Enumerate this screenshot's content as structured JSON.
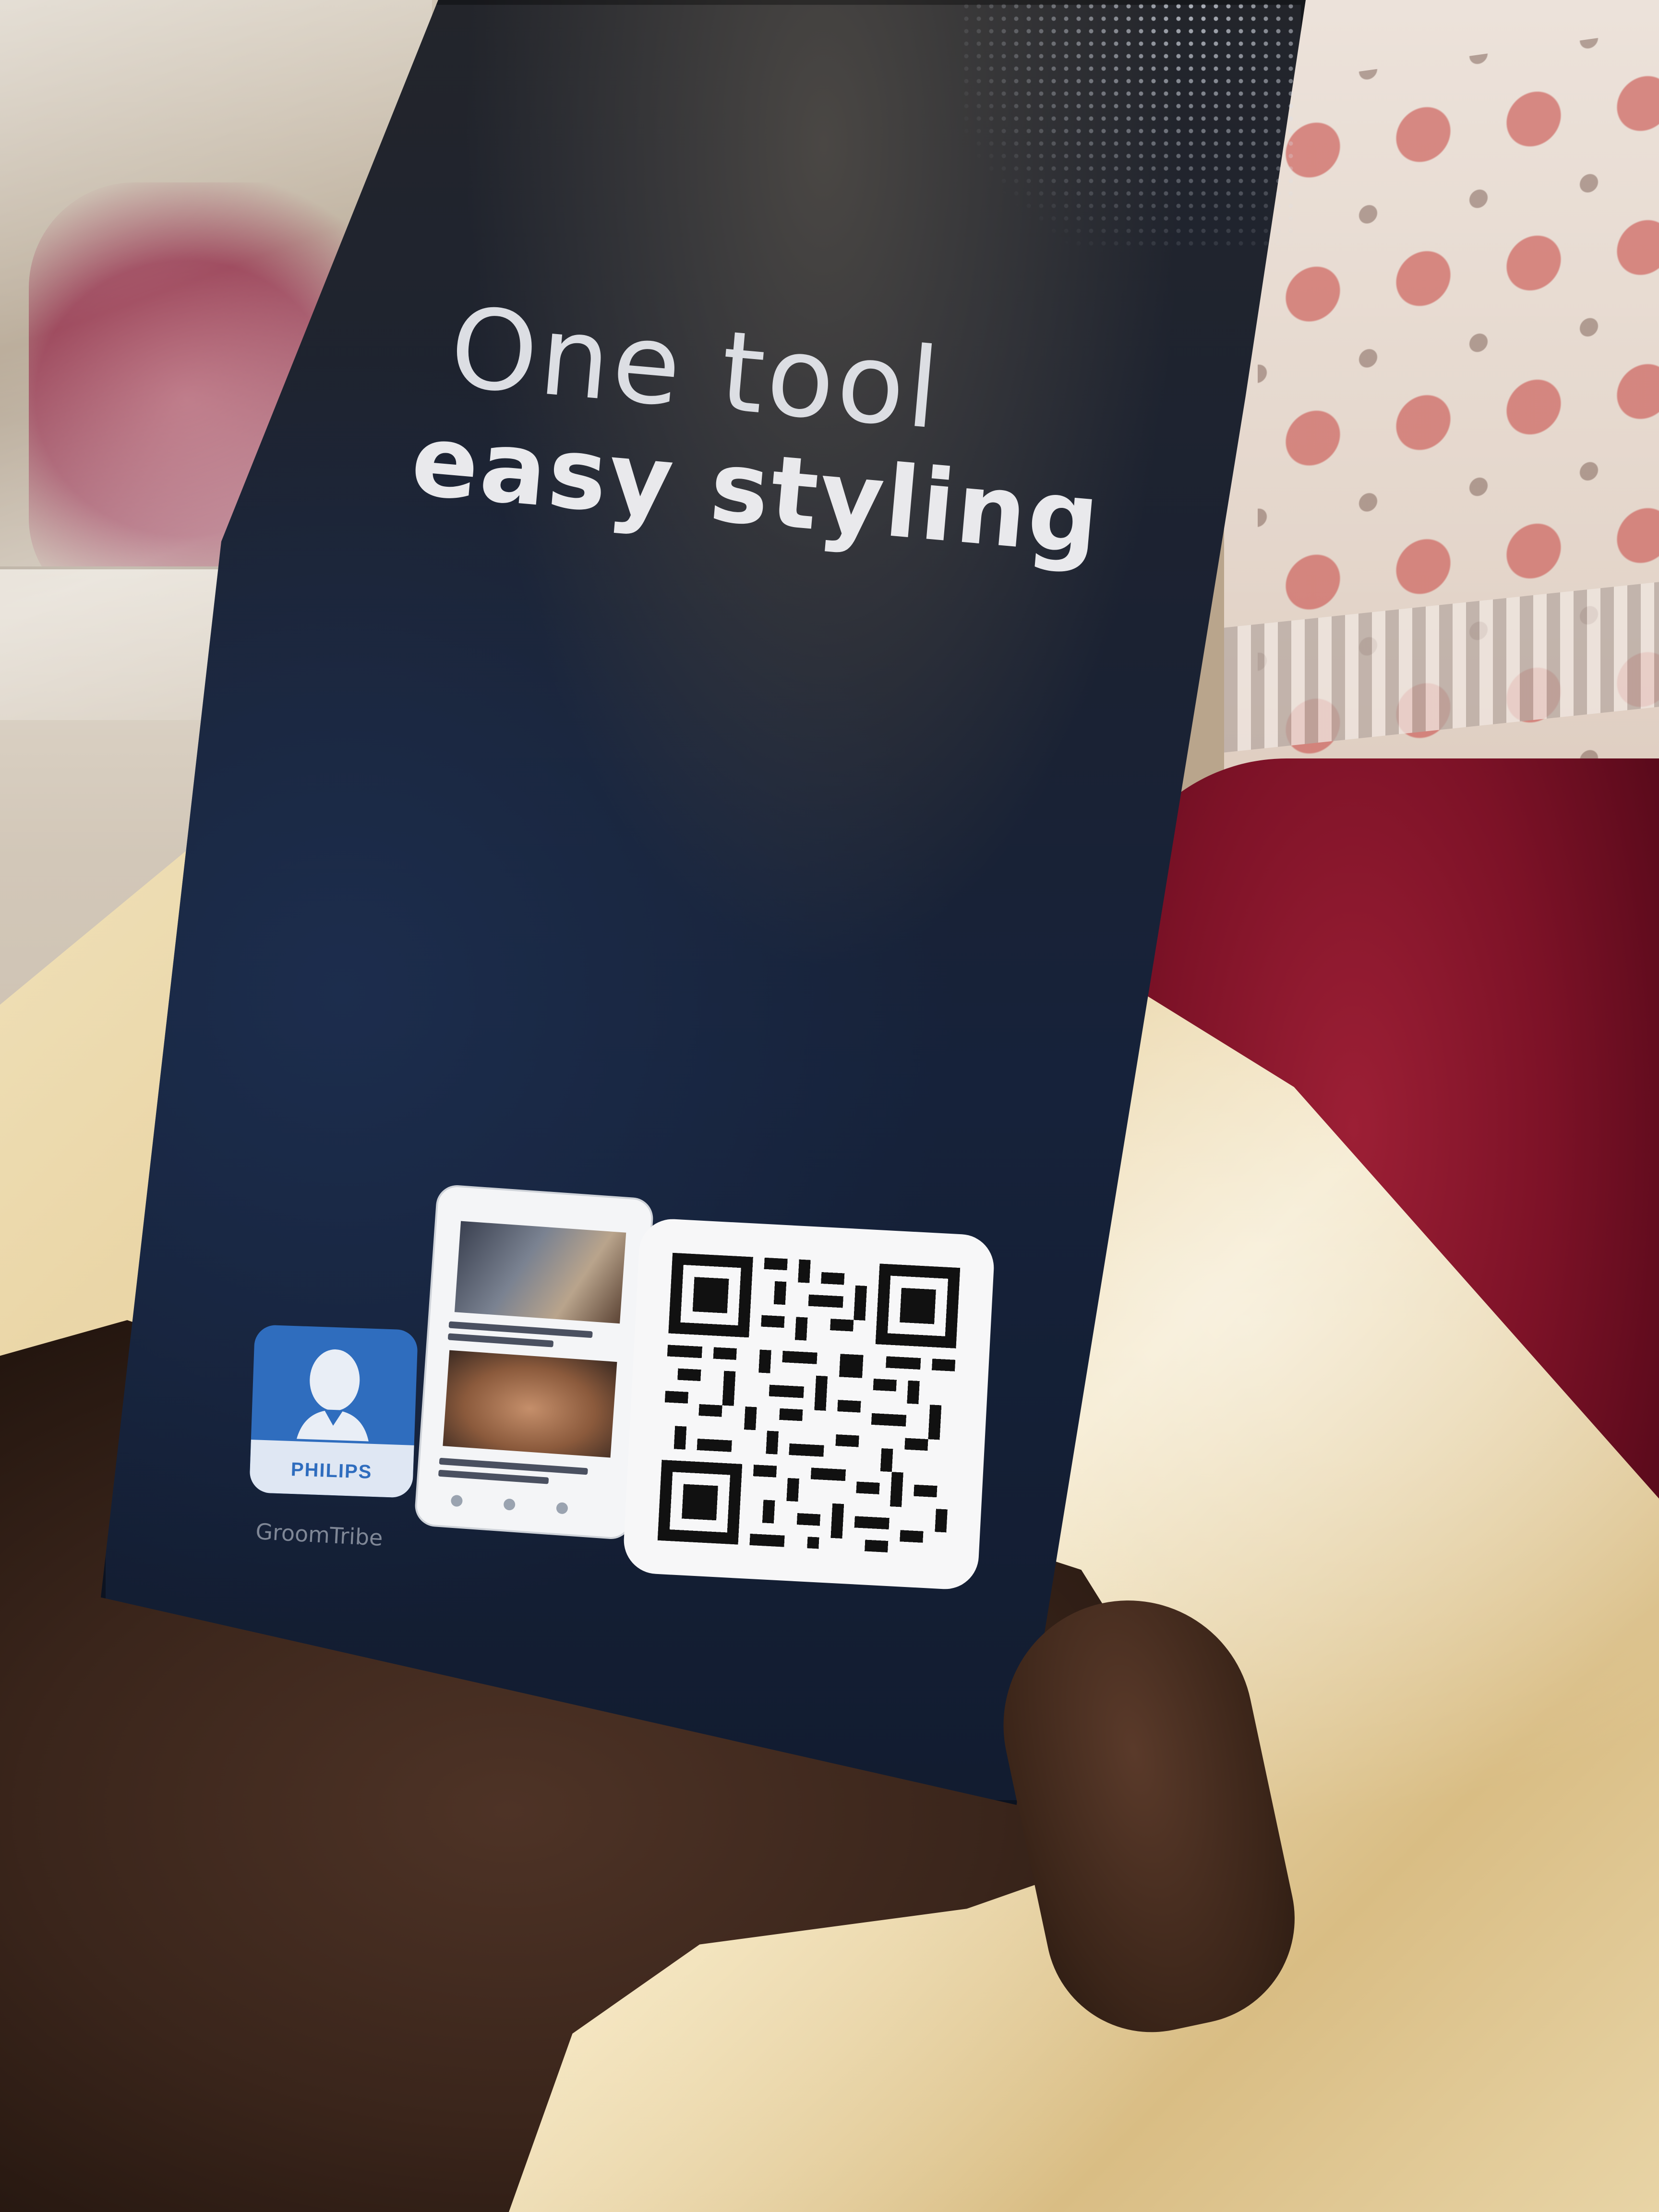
{
  "headline": {
    "line1": "One tool",
    "line2": "easy styling"
  },
  "app": {
    "icon_brand": "PHILIPS",
    "name": "GroomTribe"
  },
  "colors": {
    "box": "#16223a",
    "headline": "#e5e6ea",
    "app_icon": "#2f6dbe"
  },
  "icons": {
    "app_icon": "philips-groomtribe-app-icon",
    "qr": "qr-code"
  }
}
